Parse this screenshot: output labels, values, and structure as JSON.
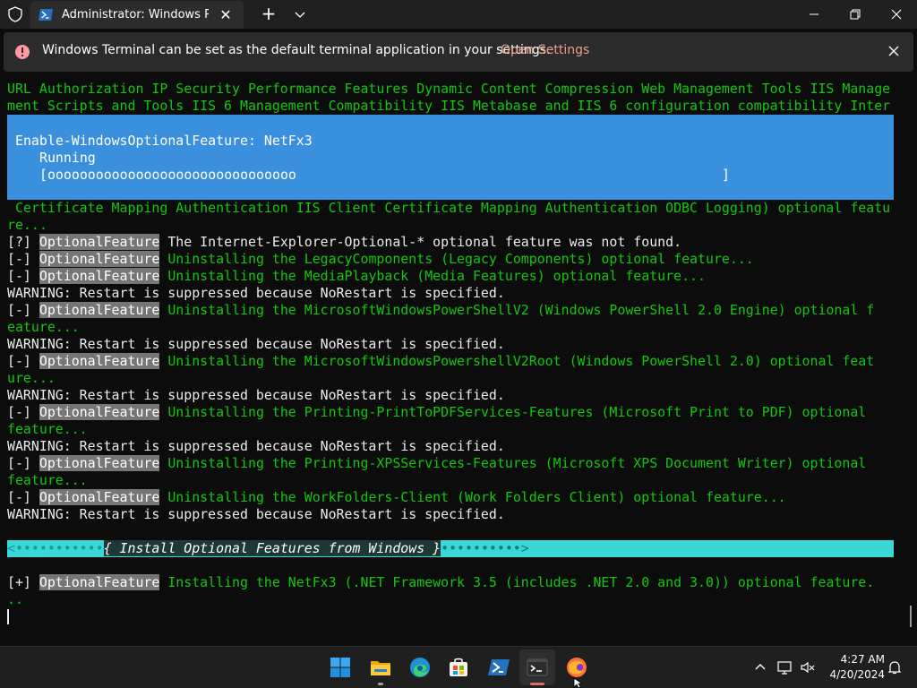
{
  "window": {
    "tab_title": "Administrator: Windows PowerShell",
    "new_tab_label": "+"
  },
  "infobar": {
    "message": "Windows Terminal can be set as the default terminal application in your settings.",
    "link": "Open Settings"
  },
  "terminal": {
    "lines_top": [
      "URL Authorization IP Security Performance Features Dynamic Content Compression Web Management Tools IIS Manage",
      "ment Scripts and Tools IIS 6 Management Compatibility IIS Metabase and IIS 6 configuration compatibility Inter"
    ],
    "progress": {
      "activity": "Enable-WindowsOptionalFeature: NetFx3",
      "status": "Running",
      "bar": "[ooooooooooooooooooooooooooooooo                                                     ]"
    },
    "after_progress": [
      " Certificate Mapping Authentication IIS Client Certificate Mapping Authentication ODBC Logging) optional featu",
      "re..."
    ],
    "badge_label": "OptionalFeature",
    "warning": "WARNING: Restart is suppressed because NoRestart is specified.",
    "entries": [
      {
        "marker": "[?]",
        "text": " The Internet-Explorer-Optional-* optional feature was not found.",
        "color": "w"
      },
      {
        "marker": "[-]",
        "text": " Uninstalling the LegacyComponents (Legacy Components) optional feature...",
        "color": "g"
      },
      {
        "marker": "[-]",
        "text": " Uninstalling the MediaPlayback (Media Features) optional feature...",
        "color": "g"
      },
      {
        "marker": "[-]",
        "text": " Uninstalling the MicrosoftWindowsPowerShellV2 (Windows PowerShell 2.0 Engine) optional f",
        "cont": "eature...",
        "color": "g"
      },
      {
        "marker": "[-]",
        "text": " Uninstalling the MicrosoftWindowsPowershellV2Root (Windows PowerShell 2.0) optional feat",
        "cont": "ure...",
        "color": "g"
      },
      {
        "marker": "[-]",
        "text": " Uninstalling the Printing-PrintToPDFServices-Features (Microsoft Print to PDF) optional",
        "cont": "feature...",
        "color": "g"
      },
      {
        "marker": "[-]",
        "text": " Uninstalling the Printing-XPSServices-Features (Microsoft XPS Document Writer) optional",
        "cont": "feature...",
        "color": "g"
      },
      {
        "marker": "[-]",
        "text": " Uninstalling the WorkFolders-Client (Work Folders Client) optional feature...",
        "color": "g"
      }
    ],
    "banner": {
      "left_dots": "<•••••••••••",
      "title": "{ Install Optional Features from Windows }",
      "right_dots": "••••••••••>"
    },
    "install": {
      "marker": "[+]",
      "text": " Installing the NetFx3 (.NET Framework 3.5 (includes .NET 2.0 and 3.0)) optional feature.",
      "cont": ".."
    }
  },
  "taskbar": {
    "apps": [
      "windows-start",
      "file-explorer",
      "edge",
      "microsoft-store",
      "powershell",
      "windows-terminal",
      "firefox"
    ],
    "time": "4:27 AM",
    "date": "4/20/2024"
  },
  "colors": {
    "terminal_bg": "#0c0c0c",
    "green": "#14c70e",
    "progress_bg": "#3b90de",
    "banner_bg": "#3bd6d6",
    "badge_bg": "#767676",
    "link": "#e7a08b"
  }
}
